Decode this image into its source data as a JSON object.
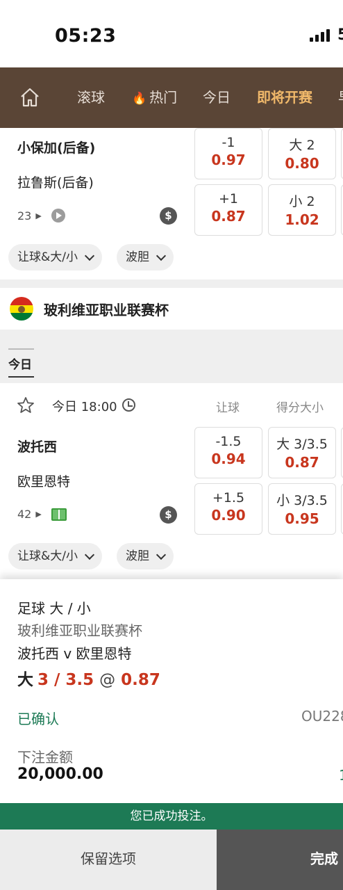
{
  "status_bar": {
    "time": "05:23",
    "extra": "5"
  },
  "nav": {
    "items": [
      "滚球",
      "热门",
      "今日",
      "即将开赛",
      "早"
    ],
    "active": "即将开赛"
  },
  "match1": {
    "home": "小保加(后备)",
    "away": "拉鲁斯(后备)",
    "markets_count": "23",
    "odds": [
      {
        "line": "-1",
        "price": "0.97"
      },
      {
        "line": "大 2",
        "price": "0.80"
      },
      {
        "line": "+1",
        "price": "0.87"
      },
      {
        "line": "小 2",
        "price": "1.02"
      }
    ],
    "chips": [
      "让球&大/小",
      "波胆"
    ]
  },
  "league": {
    "name": "玻利维亚职业联赛杯"
  },
  "date_tab": "今日",
  "match2": {
    "time": "今日 18:00",
    "col_handicap": "让球",
    "col_total": "得分大小",
    "home": "波托西",
    "away": "欧里恩特",
    "markets_count": "42",
    "odds": [
      {
        "line": "-1.5",
        "price": "0.94"
      },
      {
        "line": "大 3/3.5",
        "price": "0.87"
      },
      {
        "line": "+1.5",
        "price": "0.90"
      },
      {
        "line": "小 3/3.5",
        "price": "0.95"
      }
    ],
    "chips": [
      "让球&大/小",
      "波胆"
    ]
  },
  "bet_slip": {
    "market": "足球 大 / 小",
    "league": "玻利维亚职业联赛杯",
    "event": "波托西 v 欧里恩特",
    "selection_side": "大",
    "selection_line": "3 / 3.5",
    "at": "@",
    "price": "0.87",
    "status": "已确认",
    "ref": "OU228",
    "stake_label": "下注金额",
    "stake": "20,000.00",
    "right_value": "1",
    "success_message": "您已成功投注。",
    "keep_button": "保留选项",
    "done_button": "完成"
  },
  "colors": {
    "nav_bg": "#5a4536",
    "nav_active": "#f0b86a",
    "odds_red": "#c8361e",
    "success_green": "#1d7a55"
  }
}
